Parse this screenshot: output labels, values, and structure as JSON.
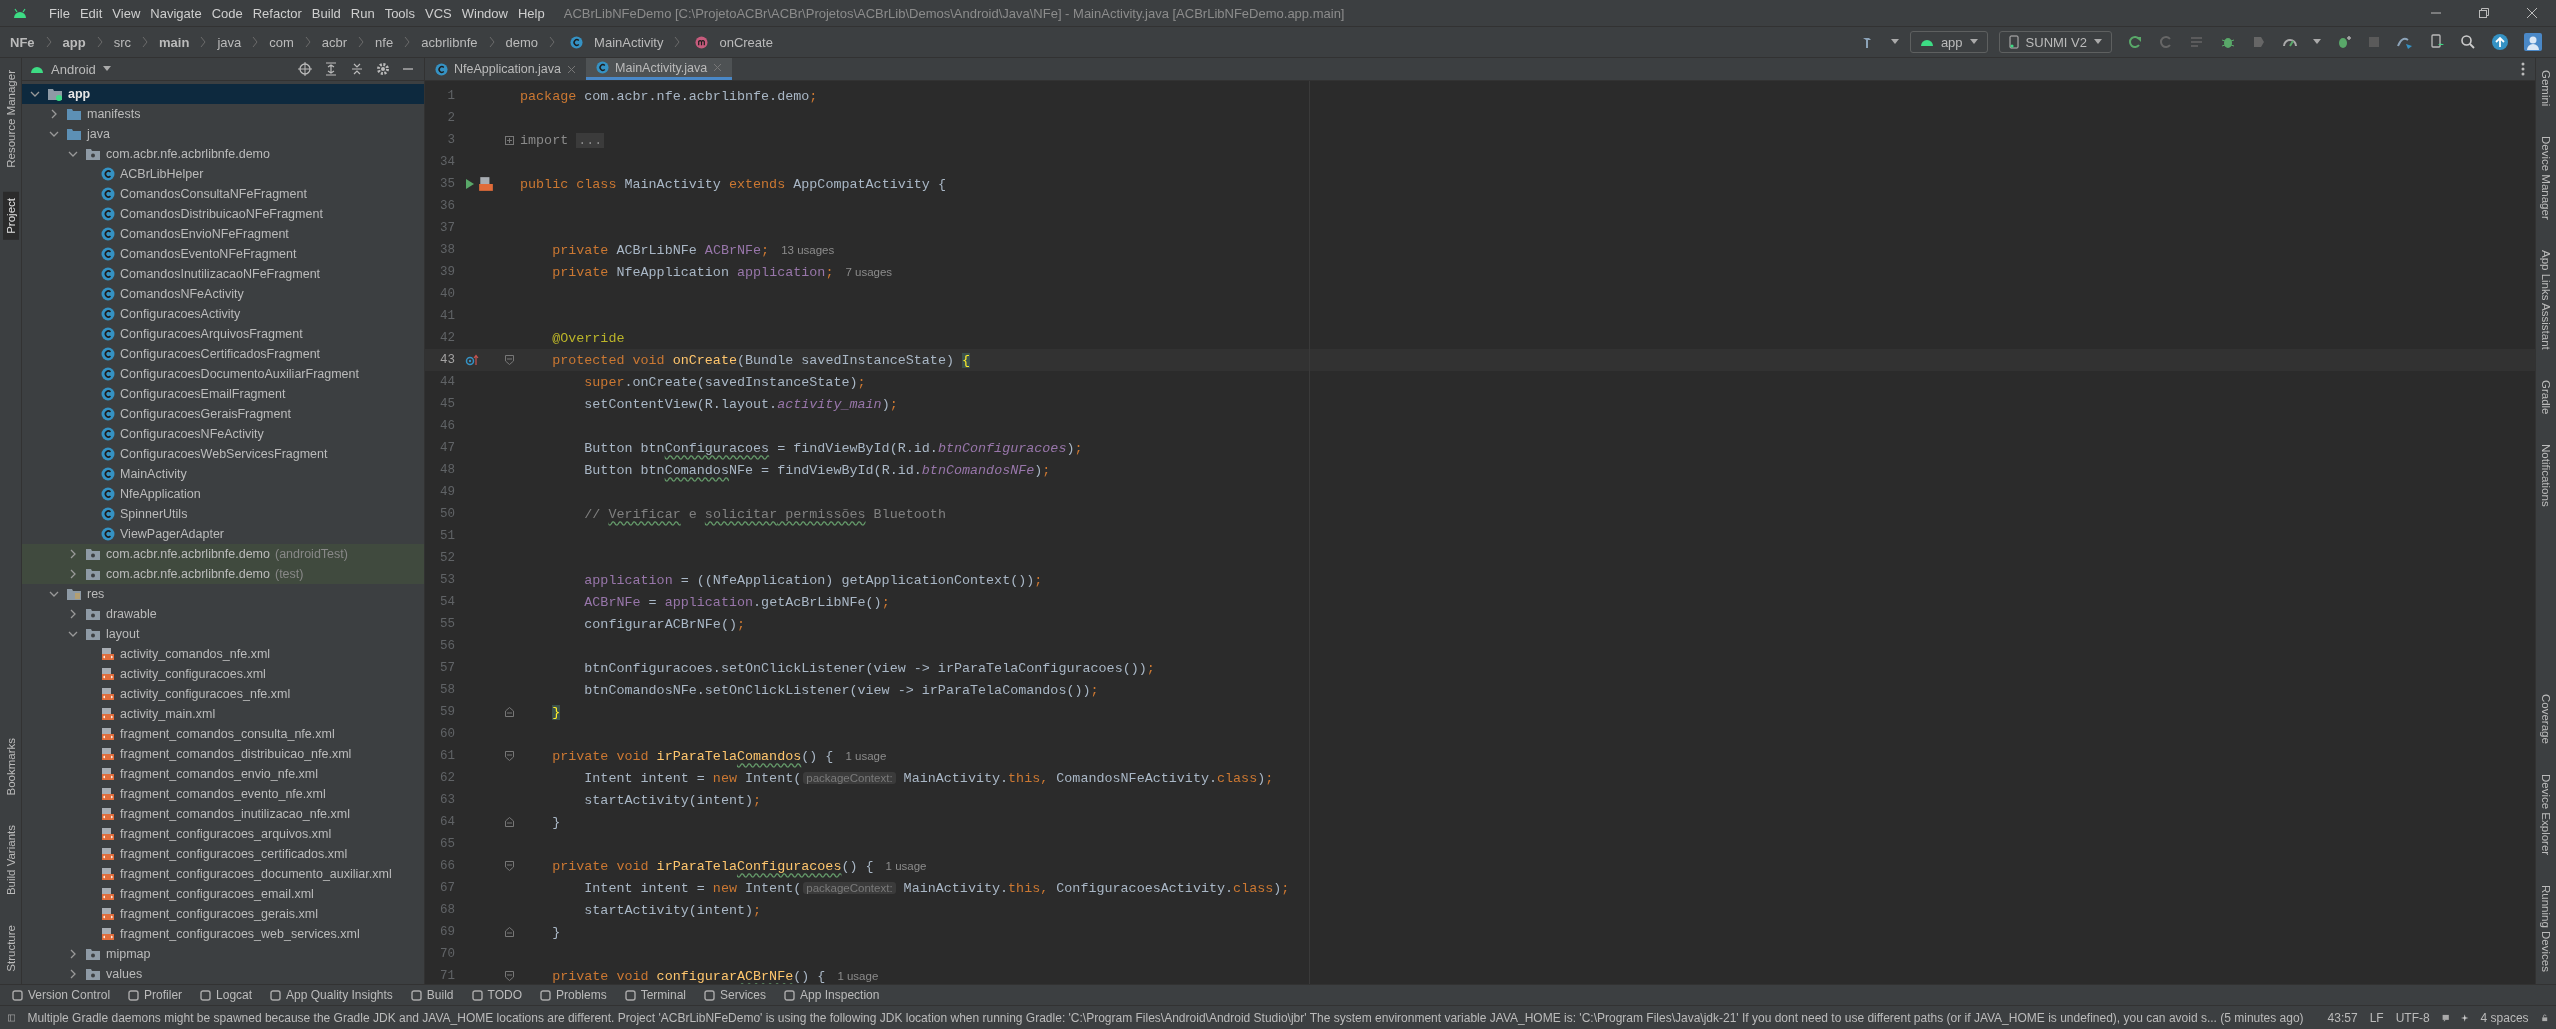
{
  "menu_bar": {
    "items": [
      "File",
      "Edit",
      "View",
      "Navigate",
      "Code",
      "Refactor",
      "Build",
      "Run",
      "Tools",
      "VCS",
      "Window",
      "Help"
    ],
    "title": "ACBrLibNFeDemo [C:\\ProjetoACBr\\ACBr\\Projetos\\ACBrLib\\Demos\\Android\\Java\\NFe] - MainActivity.java [ACBrLibNFeDemo.app.main]"
  },
  "nav_bar": {
    "breadcrumb": [
      {
        "label": "NFe",
        "kind": "text",
        "bold": true
      },
      {
        "label": "app",
        "kind": "text",
        "bold": true
      },
      {
        "label": "src",
        "kind": "text",
        "bold": false
      },
      {
        "label": "main",
        "kind": "text",
        "bold": true
      },
      {
        "label": "java",
        "kind": "text",
        "bold": false
      },
      {
        "label": "com",
        "kind": "text",
        "bold": false
      },
      {
        "label": "acbr",
        "kind": "text",
        "bold": false
      },
      {
        "label": "nfe",
        "kind": "text",
        "bold": false
      },
      {
        "label": "acbrlibnfe",
        "kind": "text",
        "bold": false
      },
      {
        "label": "demo",
        "kind": "text",
        "bold": false
      },
      {
        "label": "MainActivity",
        "kind": "class",
        "bold": false
      },
      {
        "label": "onCreate",
        "kind": "method",
        "bold": false
      }
    ],
    "run_config": "app",
    "device": "SUNMI V2"
  },
  "left_strip": [
    {
      "label": "Resource Manager",
      "selected": false,
      "kind": "top"
    },
    {
      "label": "Project",
      "selected": true,
      "kind": "top"
    },
    {
      "label": "Bookmarks",
      "selected": false,
      "kind": "bottom"
    },
    {
      "label": "Build Variants",
      "selected": false,
      "kind": "bottom"
    },
    {
      "label": "Structure",
      "selected": false,
      "kind": "bottom"
    }
  ],
  "project": {
    "view": "Android",
    "tree": [
      {
        "label": "app",
        "kind": "module",
        "expanded": true,
        "selected": true,
        "children": [
          {
            "label": "manifests",
            "kind": "folder",
            "expanded": false,
            "selected": false
          },
          {
            "label": "java",
            "kind": "folder",
            "expanded": true,
            "selected": false,
            "children": [
              {
                "label": "com.acbr.nfe.acbrlibnfe.demo",
                "kind": "package",
                "expanded": true,
                "selected": false,
                "children": [
                  {
                    "label": "ACBrLibHelper",
                    "kind": "class",
                    "selected": false
                  },
                  {
                    "label": "ComandosConsultaNFeFragment",
                    "kind": "class",
                    "selected": false
                  },
                  {
                    "label": "ComandosDistribuicaoNFeFragment",
                    "kind": "class",
                    "selected": false
                  },
                  {
                    "label": "ComandosEnvioNFeFragment",
                    "kind": "class",
                    "selected": false
                  },
                  {
                    "label": "ComandosEventoNFeFragment",
                    "kind": "class",
                    "selected": false
                  },
                  {
                    "label": "ComandosInutilizacaoNFeFragment",
                    "kind": "class",
                    "selected": false
                  },
                  {
                    "label": "ComandosNFeActivity",
                    "kind": "class",
                    "selected": false
                  },
                  {
                    "label": "ConfiguracoesActivity",
                    "kind": "class",
                    "selected": false
                  },
                  {
                    "label": "ConfiguracoesArquivosFragment",
                    "kind": "class",
                    "selected": false
                  },
                  {
                    "label": "ConfiguracoesCertificadosFragment",
                    "kind": "class",
                    "selected": false
                  },
                  {
                    "label": "ConfiguracoesDocumentoAuxiliarFragment",
                    "kind": "class",
                    "selected": false
                  },
                  {
                    "label": "ConfiguracoesEmailFragment",
                    "kind": "class",
                    "selected": false
                  },
                  {
                    "label": "ConfiguracoesGeraisFragment",
                    "kind": "class",
                    "selected": false
                  },
                  {
                    "label": "ConfiguracoesNFeActivity",
                    "kind": "class",
                    "selected": false
                  },
                  {
                    "label": "ConfiguracoesWebServicesFragment",
                    "kind": "class",
                    "selected": false
                  },
                  {
                    "label": "MainActivity",
                    "kind": "class",
                    "selected": false
                  },
                  {
                    "label": "NfeApplication",
                    "kind": "class",
                    "selected": false
                  },
                  {
                    "label": "SpinnerUtils",
                    "kind": "class",
                    "selected": false
                  },
                  {
                    "label": "ViewPagerAdapter",
                    "kind": "class",
                    "selected": false
                  }
                ]
              },
              {
                "label": "com.acbr.nfe.acbrlibnfe.demo",
                "suffix": "(androidTest)",
                "kind": "test_package",
                "expanded": false,
                "selected": false
              },
              {
                "label": "com.acbr.nfe.acbrlibnfe.demo",
                "suffix": "(test)",
                "kind": "test_package",
                "expanded": false,
                "selected": false
              }
            ]
          },
          {
            "label": "res",
            "kind": "res",
            "expanded": true,
            "selected": false,
            "children": [
              {
                "label": "drawable",
                "kind": "package",
                "expanded": false,
                "selected": false
              },
              {
                "label": "layout",
                "kind": "package",
                "expanded": true,
                "selected": false,
                "children": [
                  {
                    "label": "activity_comandos_nfe.xml",
                    "kind": "xml",
                    "selected": false
                  },
                  {
                    "label": "activity_configuracoes.xml",
                    "kind": "xml",
                    "selected": false
                  },
                  {
                    "label": "activity_configuracoes_nfe.xml",
                    "kind": "xml",
                    "selected": false
                  },
                  {
                    "label": "activity_main.xml",
                    "kind": "xml",
                    "selected": false
                  },
                  {
                    "label": "fragment_comandos_consulta_nfe.xml",
                    "kind": "xml",
                    "selected": false
                  },
                  {
                    "label": "fragment_comandos_distribuicao_nfe.xml",
                    "kind": "xml",
                    "selected": false
                  },
                  {
                    "label": "fragment_comandos_envio_nfe.xml",
                    "kind": "xml",
                    "selected": false
                  },
                  {
                    "label": "fragment_comandos_evento_nfe.xml",
                    "kind": "xml",
                    "selected": false
                  },
                  {
                    "label": "fragment_comandos_inutilizacao_nfe.xml",
                    "kind": "xml",
                    "selected": false
                  },
                  {
                    "label": "fragment_configuracoes_arquivos.xml",
                    "kind": "xml",
                    "selected": false
                  },
                  {
                    "label": "fragment_configuracoes_certificados.xml",
                    "kind": "xml",
                    "selected": false
                  },
                  {
                    "label": "fragment_configuracoes_documento_auxiliar.xml",
                    "kind": "xml",
                    "selected": false
                  },
                  {
                    "label": "fragment_configuracoes_email.xml",
                    "kind": "xml",
                    "selected": false
                  },
                  {
                    "label": "fragment_configuracoes_gerais.xml",
                    "kind": "xml",
                    "selected": false
                  },
                  {
                    "label": "fragment_configuracoes_web_services.xml",
                    "kind": "xml",
                    "selected": false
                  }
                ]
              },
              {
                "label": "mipmap",
                "kind": "package",
                "expanded": false,
                "selected": false
              },
              {
                "label": "values",
                "kind": "package",
                "expanded": false,
                "selected": false
              }
            ]
          }
        ]
      }
    ]
  },
  "editor": {
    "tabs": [
      {
        "label": "NfeApplication.java",
        "selected": false
      },
      {
        "label": "MainActivity.java",
        "selected": true
      }
    ],
    "lines": [
      {
        "number": "1",
        "current": false,
        "tokens": [
          {
            "kind": "kw",
            "text": "package"
          },
          {
            "kind": "pl",
            "text": " com.acbr.nfe.acbrlibnfe.demo"
          },
          {
            "kind": "kw",
            "text": ";"
          }
        ]
      },
      {
        "number": "2",
        "current": false
      },
      {
        "number": "3",
        "current": false,
        "fold_marker": {
          "kind": "collapsed"
        },
        "tokens": [
          {
            "kind": "imp",
            "text": "import "
          },
          {
            "kind": "fold",
            "text": "..."
          }
        ]
      },
      {
        "number": "34",
        "current": false
      },
      {
        "number": "35",
        "current": false,
        "gutter_icons": [
          {
            "kind": "run"
          },
          {
            "kind": "layout"
          }
        ],
        "tokens": [
          {
            "kind": "kw",
            "text": "public class "
          },
          {
            "kind": "pl",
            "text": "MainActivity "
          },
          {
            "kind": "kw",
            "text": "extends "
          },
          {
            "kind": "pl",
            "text": "AppCompatActivity {"
          }
        ]
      },
      {
        "number": "36",
        "current": false
      },
      {
        "number": "37",
        "current": false
      },
      {
        "number": "38",
        "current": false,
        "tokens": [
          {
            "kind": "kw",
            "text": "    private "
          },
          {
            "kind": "pl",
            "text": "ACBrLibNFe "
          },
          {
            "kind": "fd",
            "text": "ACBrNFe"
          },
          {
            "kind": "kw",
            "text": ";"
          },
          {
            "kind": "usage",
            "text": "13 usages"
          }
        ]
      },
      {
        "number": "39",
        "current": false,
        "tokens": [
          {
            "kind": "kw",
            "text": "    private "
          },
          {
            "kind": "pl",
            "text": "NfeApplication "
          },
          {
            "kind": "fd",
            "text": "application"
          },
          {
            "kind": "kw",
            "text": ";"
          },
          {
            "kind": "usage",
            "text": "7 usages"
          }
        ]
      },
      {
        "number": "40",
        "current": false
      },
      {
        "number": "41",
        "current": false
      },
      {
        "number": "42",
        "current": false,
        "tokens": [
          {
            "kind": "an",
            "text": "    @Override"
          }
        ]
      },
      {
        "number": "43",
        "current": true,
        "gutter_icons": [
          {
            "kind": "override"
          }
        ],
        "fold_marker": {
          "kind": "open"
        },
        "tokens": [
          {
            "kind": "kw",
            "text": "    protected void "
          },
          {
            "kind": "md",
            "text": "onCreate"
          },
          {
            "kind": "pl",
            "text": "(Bundle savedInstanceState) "
          },
          {
            "kind": "brace",
            "text": "{"
          }
        ]
      },
      {
        "number": "44",
        "current": false,
        "tokens": [
          {
            "kind": "kw",
            "text": "        super"
          },
          {
            "kind": "pl",
            "text": ".onCreate(savedInstanceState)"
          },
          {
            "kind": "kw",
            "text": ";"
          }
        ]
      },
      {
        "number": "45",
        "current": false,
        "tokens": [
          {
            "kind": "pl",
            "text": "        setContentView(R.layout."
          },
          {
            "kind": "fdi",
            "text": "activity_main"
          },
          {
            "kind": "pl",
            "text": ")"
          },
          {
            "kind": "kw",
            "text": ";"
          }
        ]
      },
      {
        "number": "46",
        "current": false
      },
      {
        "number": "47",
        "current": false,
        "tokens": [
          {
            "kind": "pl",
            "text": "        Button btn"
          },
          {
            "kind": "plw",
            "text": "Configuracoes"
          },
          {
            "kind": "pl",
            "text": " = findViewById(R.id."
          },
          {
            "kind": "fdi",
            "text": "btnConfiguracoes"
          },
          {
            "kind": "pl",
            "text": ")"
          },
          {
            "kind": "kw",
            "text": ";"
          }
        ]
      },
      {
        "number": "48",
        "current": false,
        "tokens": [
          {
            "kind": "pl",
            "text": "        Button btn"
          },
          {
            "kind": "plw",
            "text": "Comandos"
          },
          {
            "kind": "pl",
            "text": "NFe = findViewById(R.id."
          },
          {
            "kind": "fdi",
            "text": "btnComandosNFe"
          },
          {
            "kind": "pl",
            "text": ")"
          },
          {
            "kind": "kw",
            "text": ";"
          }
        ]
      },
      {
        "number": "49",
        "current": false
      },
      {
        "number": "50",
        "current": false,
        "tokens": [
          {
            "kind": "cm",
            "text": "        // "
          },
          {
            "kind": "cmw",
            "text": "Verificar"
          },
          {
            "kind": "cm",
            "text": " e "
          },
          {
            "kind": "cmw",
            "text": "solicitar"
          },
          {
            "kind": "cmw",
            "text": " permissões"
          },
          {
            "kind": "cm",
            "text": " Bluetooth"
          }
        ]
      },
      {
        "number": "51",
        "current": false
      },
      {
        "number": "52",
        "current": false
      },
      {
        "number": "53",
        "current": false,
        "tokens": [
          {
            "kind": "fd",
            "text": "        application"
          },
          {
            "kind": "pl",
            "text": " = ((NfeApplication) getApplicationContext())"
          },
          {
            "kind": "kw",
            "text": ";"
          }
        ]
      },
      {
        "number": "54",
        "current": false,
        "tokens": [
          {
            "kind": "fd",
            "text": "        ACBrNFe"
          },
          {
            "kind": "pl",
            "text": " = "
          },
          {
            "kind": "fd",
            "text": "application"
          },
          {
            "kind": "pl",
            "text": ".getAcBrLibNFe()"
          },
          {
            "kind": "kw",
            "text": ";"
          }
        ]
      },
      {
        "number": "55",
        "current": false,
        "tokens": [
          {
            "kind": "pl",
            "text": "        configurarACBrNFe()"
          },
          {
            "kind": "kw",
            "text": ";"
          }
        ]
      },
      {
        "number": "56",
        "current": false
      },
      {
        "number": "57",
        "current": false,
        "tokens": [
          {
            "kind": "pl",
            "text": "        btnConfiguracoes.setOnClickListener(view -> irParaTelaConfiguracoes())"
          },
          {
            "kind": "kw",
            "text": ";"
          }
        ]
      },
      {
        "number": "58",
        "current": false,
        "tokens": [
          {
            "kind": "pl",
            "text": "        btnComandosNFe.setOnClickListener(view -> irParaTelaComandos())"
          },
          {
            "kind": "kw",
            "text": ";"
          }
        ]
      },
      {
        "number": "59",
        "current": false,
        "fold_marker": {
          "kind": "close"
        },
        "tokens": [
          {
            "kind": "brace-indented",
            "text": "}"
          }
        ]
      },
      {
        "number": "60",
        "current": false
      },
      {
        "number": "61",
        "current": false,
        "fold_marker": {
          "kind": "open"
        },
        "tokens": [
          {
            "kind": "kw",
            "text": "    private void "
          },
          {
            "kind": "md",
            "text": "irParaTela"
          },
          {
            "kind": "mdw",
            "text": "Comandos"
          },
          {
            "kind": "pl",
            "text": "() {"
          },
          {
            "kind": "usage",
            "text": "1 usage"
          }
        ]
      },
      {
        "number": "62",
        "current": false,
        "tokens": [
          {
            "kind": "pl",
            "text": "        Intent intent = "
          },
          {
            "kind": "kw",
            "text": "new "
          },
          {
            "kind": "pl",
            "text": "Intent("
          },
          {
            "kind": "hint",
            "text": "packageContext:"
          },
          {
            "kind": "pl",
            "text": " MainActivity."
          },
          {
            "kind": "kw",
            "text": "this, "
          },
          {
            "kind": "pl",
            "text": "ComandosNFeActivity."
          },
          {
            "kind": "kw",
            "text": "class"
          },
          {
            "kind": "pl",
            "text": ")"
          },
          {
            "kind": "kw",
            "text": ";"
          }
        ]
      },
      {
        "number": "63",
        "current": false,
        "tokens": [
          {
            "kind": "pl",
            "text": "        startActivity(intent)"
          },
          {
            "kind": "kw",
            "text": ";"
          }
        ]
      },
      {
        "number": "64",
        "current": false,
        "fold_marker": {
          "kind": "close"
        },
        "tokens": [
          {
            "kind": "pl",
            "text": "    }"
          }
        ]
      },
      {
        "number": "65",
        "current": false
      },
      {
        "number": "66",
        "current": false,
        "fold_marker": {
          "kind": "open"
        },
        "tokens": [
          {
            "kind": "kw",
            "text": "    private void "
          },
          {
            "kind": "md",
            "text": "irParaTela"
          },
          {
            "kind": "mdw",
            "text": "Configuracoes"
          },
          {
            "kind": "pl",
            "text": "() {"
          },
          {
            "kind": "usage",
            "text": "1 usage"
          }
        ]
      },
      {
        "number": "67",
        "current": false,
        "tokens": [
          {
            "kind": "pl",
            "text": "        Intent intent = "
          },
          {
            "kind": "kw",
            "text": "new "
          },
          {
            "kind": "pl",
            "text": "Intent("
          },
          {
            "kind": "hint",
            "text": "packageContext:"
          },
          {
            "kind": "pl",
            "text": " MainActivity."
          },
          {
            "kind": "kw",
            "text": "this, "
          },
          {
            "kind": "pl",
            "text": "ConfiguracoesActivity."
          },
          {
            "kind": "kw",
            "text": "class"
          },
          {
            "kind": "pl",
            "text": ")"
          },
          {
            "kind": "kw",
            "text": ";"
          }
        ]
      },
      {
        "number": "68",
        "current": false,
        "tokens": [
          {
            "kind": "pl",
            "text": "        startActivity(intent)"
          },
          {
            "kind": "kw",
            "text": ";"
          }
        ]
      },
      {
        "number": "69",
        "current": false,
        "fold_marker": {
          "kind": "close"
        },
        "tokens": [
          {
            "kind": "pl",
            "text": "    }"
          }
        ]
      },
      {
        "number": "70",
        "current": false
      },
      {
        "number": "71",
        "current": false,
        "fold_marker": {
          "kind": "open"
        },
        "tokens": [
          {
            "kind": "kw",
            "text": "    private void "
          },
          {
            "kind": "md",
            "text": "configurar"
          },
          {
            "kind": "mdw",
            "text": "ACBrNFe"
          },
          {
            "kind": "pl",
            "text": "() {"
          },
          {
            "kind": "usage",
            "text": "1 usage"
          }
        ]
      }
    ]
  },
  "right_strip": [
    {
      "label": "Gemini",
      "kind": "top"
    },
    {
      "label": "Device Manager",
      "kind": "top"
    },
    {
      "label": "App Links Assistant",
      "kind": "top"
    },
    {
      "label": "Gradle",
      "kind": "top"
    },
    {
      "label": "Notifications",
      "kind": "top"
    },
    {
      "label": "Coverage",
      "kind": "bottom"
    },
    {
      "label": "Device Explorer",
      "kind": "bottom"
    },
    {
      "label": "Running Devices",
      "kind": "bottom"
    }
  ],
  "tool_windows": [
    "Version Control",
    "Profiler",
    "Logcat",
    "App Quality Insights",
    "Build",
    "TODO",
    "Problems",
    "Terminal",
    "Services",
    "App Inspection"
  ],
  "status_bar": {
    "message": "Multiple Gradle daemons might be spawned because the Gradle JDK and JAVA_HOME locations are different. Project 'ACBrLibNFeDemo' is using the following JDK location when running Gradle: 'C:\\Program Files\\Android\\Android Studio\\jbr' The system environment variable JAVA_HOME is: 'C:\\Program Files\\Java\\jdk-21' If you dont need to use different paths (or if JAVA_HOME is undefined), you can avoid s... (5 minutes ago)",
    "position": "43:57",
    "line_separator": "LF",
    "encoding": "UTF-8",
    "indent": "4 spaces"
  }
}
